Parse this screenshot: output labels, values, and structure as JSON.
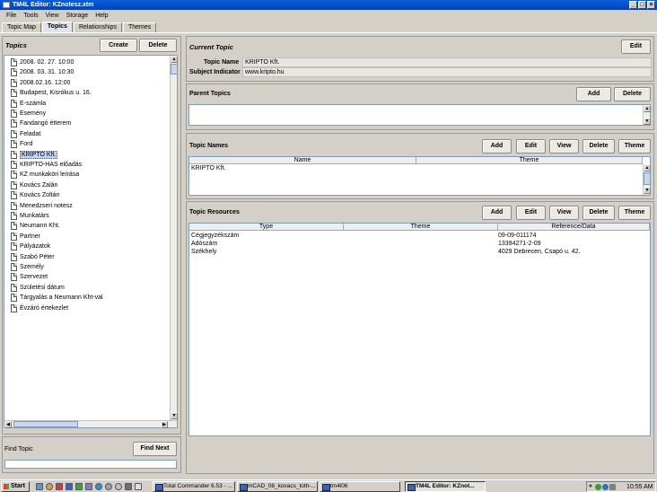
{
  "window": {
    "title": "TM4L Editor: KZnotesz.xtm"
  },
  "menu": [
    "File",
    "Tools",
    "View",
    "Storage",
    "Help"
  ],
  "tabs": [
    "Topic Map",
    "Topics",
    "Relationships",
    "Themes"
  ],
  "active_tab": "Topics",
  "topics_panel": {
    "title": "Topics",
    "create_label": "Create",
    "delete_label": "Delete",
    "items": [
      "2008. 02. 27. 10:00",
      "2008. 03. 31. 10:30",
      "2008.02.16. 12:00",
      "Budapest, Kisrókus u. 16.",
      "E-számla",
      "Esemény",
      "Fandangó étterem",
      "Feladat",
      "Ford",
      "KRIPTO Kft.",
      "KRIPTO-HAS előadás",
      "KZ munkaköri leírása",
      "Kovács Zalán",
      "Kovács Zoltán",
      "Menedzseri notesz",
      "Munkatárs",
      "Neumann Kht.",
      "Partner",
      "Pályázatok",
      "Szabó Péter",
      "Személy",
      "Szervezet",
      "Születési dátum",
      "Tárgyalás a Neumann Kht-val",
      "Évzáró értekezlet"
    ],
    "selected": "KRIPTO Kft."
  },
  "find_topic": {
    "label": "Find Topic",
    "button": "Find Next",
    "value": ""
  },
  "current_topic": {
    "title": "Current Topic",
    "edit_label": "Edit",
    "topic_name_label": "Topic Name",
    "topic_name": "KRIPTO Kft.",
    "subject_indicator_label": "Subject Indicator",
    "subject_indicator": "www.kripto.hu"
  },
  "parent_topics": {
    "title": "Parent Topics",
    "add_label": "Add",
    "delete_label": "Delete"
  },
  "topic_names": {
    "title": "Topic Names",
    "buttons": [
      "Add",
      "Edit",
      "View",
      "Delete",
      "Theme"
    ],
    "columns": [
      "Name",
      "Theme"
    ],
    "rows": [
      [
        "KRIPTO Kft.",
        ""
      ]
    ]
  },
  "topic_resources": {
    "title": "Topic Resources",
    "buttons": [
      "Add",
      "Edit",
      "View",
      "Delete",
      "Theme"
    ],
    "columns": [
      "Type",
      "Theme",
      "Reference/Data"
    ],
    "rows": [
      [
        "Cégjegyzékszám",
        "",
        "09-09-011174"
      ],
      [
        "Adószám",
        "",
        "13394271-2-09"
      ],
      [
        "Székhely",
        "",
        "4029 Debrecen, Csapó u. 42."
      ]
    ]
  },
  "taskbar": {
    "start_label": "Start",
    "tasks": [
      "Total Commander 6.53 - ...",
      "mCAD_08_kovacs_toth-...",
      "tm4l06",
      "TM4L Editor: KZnot..."
    ],
    "active_task": "TM4L Editor: KZnot...",
    "tray_arrow": "«",
    "clock": "10:55 AM"
  },
  "colors": {
    "title_bar": "#0a5fd8",
    "selection": "#c3d3f0",
    "window_bg": "#d4d0c8"
  }
}
